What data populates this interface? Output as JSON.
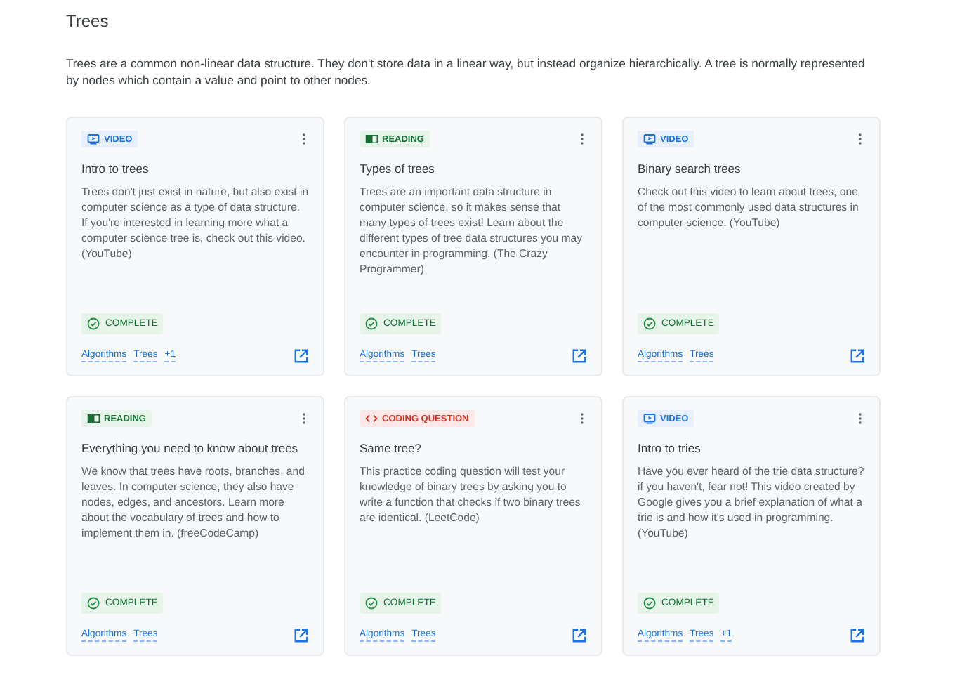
{
  "heading": "Trees",
  "description": "Trees are a common non-linear data structure. They don't store data in a linear way, but instead organize hierarchically. A tree is normally represented by nodes which contain a value and point to other nodes.",
  "cards": [
    {
      "kind": "video",
      "type_label": "VIDEO",
      "title": "Intro to trees",
      "text": "Trees don't just exist in nature, but also exist in computer science as a type of data structure. If you're interested in learning more what a computer science tree is, check out this video. (YouTube)",
      "status": "COMPLETE",
      "tags": [
        "Algorithms",
        "Trees",
        "+1"
      ]
    },
    {
      "kind": "reading",
      "type_label": "READING",
      "title": "Types of trees",
      "text": "Trees are an important data structure in computer science, so it makes sense that many types of trees exist! Learn about the different types of tree data structures you may encounter in programming. (The Crazy Programmer)",
      "status": "COMPLETE",
      "tags": [
        "Algorithms",
        "Trees"
      ]
    },
    {
      "kind": "video",
      "type_label": "VIDEO",
      "title": "Binary search trees",
      "text": "Check out this video to learn about trees, one of the most commonly used data structures in computer science. (YouTube)",
      "status": "COMPLETE",
      "tags": [
        "Algorithms",
        "Trees"
      ]
    },
    {
      "kind": "reading",
      "type_label": "READING",
      "title": "Everything you need to know about trees",
      "text": "We know that trees have roots, branches, and leaves. In computer science, they also have nodes, edges, and ancestors. Learn more about the vocabulary of trees and how to implement them in. (freeCodeCamp)",
      "status": "COMPLETE",
      "tags": [
        "Algorithms",
        "Trees"
      ]
    },
    {
      "kind": "coding",
      "type_label": "CODING QUESTION",
      "title": "Same tree?",
      "text": "This practice coding question will test your knowledge of binary trees by asking you to write a function that checks if two binary trees are identical. (LeetCode)",
      "status": "COMPLETE",
      "tags": [
        "Algorithms",
        "Trees"
      ]
    },
    {
      "kind": "video",
      "type_label": "VIDEO",
      "title": "Intro to tries",
      "text": "Have you ever heard of the trie data structure? if you haven't, fear not! This video created by Google gives you a brief explanation of what a trie is and how it's used in programming. (YouTube)",
      "status": "COMPLETE",
      "tags": [
        "Algorithms",
        "Trees",
        "+1"
      ]
    }
  ]
}
